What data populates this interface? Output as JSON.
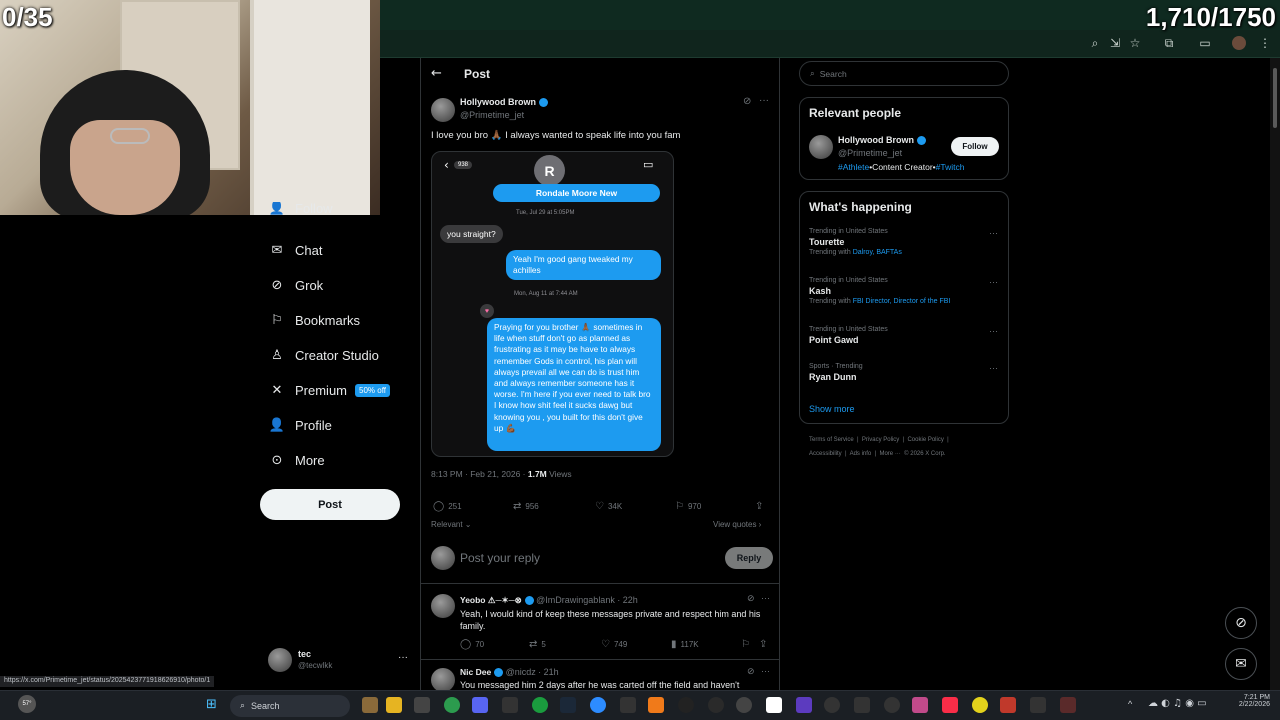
{
  "overlay": {
    "counter_left": "0/35",
    "counter_right": "1,710/1750"
  },
  "sidebar": {
    "items": [
      {
        "label": "Follow",
        "icon": "follow-icon"
      },
      {
        "label": "Chat",
        "icon": "mail-icon"
      },
      {
        "label": "Grok",
        "icon": "grok-icon"
      },
      {
        "label": "Bookmarks",
        "icon": "bookmark-icon"
      },
      {
        "label": "Creator Studio",
        "icon": "creator-studio-icon"
      },
      {
        "label": "Premium",
        "icon": "x-logo-icon",
        "badge": "50% off"
      },
      {
        "label": "Profile",
        "icon": "person-icon"
      },
      {
        "label": "More",
        "icon": "more-circle-icon"
      }
    ],
    "post_button": "Post",
    "user": {
      "name": "tec",
      "handle": "@tecwlkk"
    }
  },
  "header": {
    "title": "Post"
  },
  "post": {
    "author_name": "Hollywood Brown",
    "author_handle": "@Primetime_jet",
    "text": "I love you bro 🙏🏾 I always wanted to speak life into you fam",
    "image": {
      "contact_initial": "R",
      "contact_name": "Rondale Moore New",
      "badge_count": "938",
      "ts1": "Tue, Jul 29 at 5:05PM",
      "msg_gray": "you straight?",
      "msg_blue1": "Yeah I'm good gang tweaked my achilles",
      "ts2": "Mon, Aug 11 at 7:44 AM",
      "msg_blue2": "Praying for you brother 🙏🏾 sometimes in life when stuff don't go as planned as frustrating as it may be have to always remember Gods in control, his plan will always prevail all we can do is trust him and always remember someone has it worse. I'm here if you ever need to talk bro I know how shit feel it sucks dawg but knowing you , you built for this don't give up 💪🏾"
    },
    "meta_time": "8:13 PM · Feb 21, 2026 · ",
    "meta_views": "1.7M",
    "meta_views_label": " Views",
    "stats": {
      "replies": "251",
      "reposts": "956",
      "likes": "34K",
      "bookmarks": "970"
    },
    "relevant": "Relevant",
    "view_quotes": "View quotes",
    "reply_placeholder": "Post your reply",
    "reply_button": "Reply"
  },
  "replies": [
    {
      "name": "Yeobo ⚠︎─✶─⊗",
      "handle": "@ImDrawingablank",
      "time": "· 22h",
      "text": "Yeah, I would kind of keep these messages private and respect him and his family.",
      "stats": {
        "replies": "70",
        "reposts": "5",
        "likes": "749",
        "views": "117K"
      }
    },
    {
      "name": "Nic Dee",
      "handle": "@nicdz",
      "time": "· 21h",
      "text": "You messaged him 2 days after he was carted off the field and haven't"
    }
  ],
  "right": {
    "search_placeholder": "Search",
    "relevant_people": {
      "title": "Relevant people",
      "name": "Hollywood Brown",
      "handle": "@Primetime_jet",
      "follow": "Follow",
      "bio_tag1": "#Athlete",
      "bio_mid": "•Content Creator•",
      "bio_tag2": "#Twitch"
    },
    "happening": {
      "title": "What's happening",
      "trends": [
        {
          "context": "Trending in United States",
          "name": "Tourette",
          "with_label": "Trending with ",
          "with": "Dalroy, BAFTAs"
        },
        {
          "context": "Trending in United States",
          "name": "Kash",
          "with_label": "Trending with ",
          "with": "FBI Director, Director of the FBI"
        },
        {
          "context": "Trending in United States",
          "name": "Point Gawd",
          "with_label": "",
          "with": ""
        },
        {
          "context": "Sports · Trending",
          "name": "Ryan Dunn",
          "with_label": "",
          "with": ""
        }
      ],
      "show_more": "Show more"
    },
    "footer": {
      "line1": "Terms of Service  |  Privacy Policy  |  Cookie Policy  |",
      "line2": "Accessibility  |  Ads info  |  More ···  © 2026 X Corp."
    }
  },
  "status_url": "https://x.com/Primetime_jet/status/2025423771918626910/photo/1",
  "taskbar": {
    "search": "Search",
    "temp": "57°",
    "clock_time": "7:21 PM",
    "clock_date": "2/22/2026"
  },
  "colors": {
    "accent": "#1d9bf0",
    "background": "#000000",
    "chrome": "#0f2a20"
  }
}
